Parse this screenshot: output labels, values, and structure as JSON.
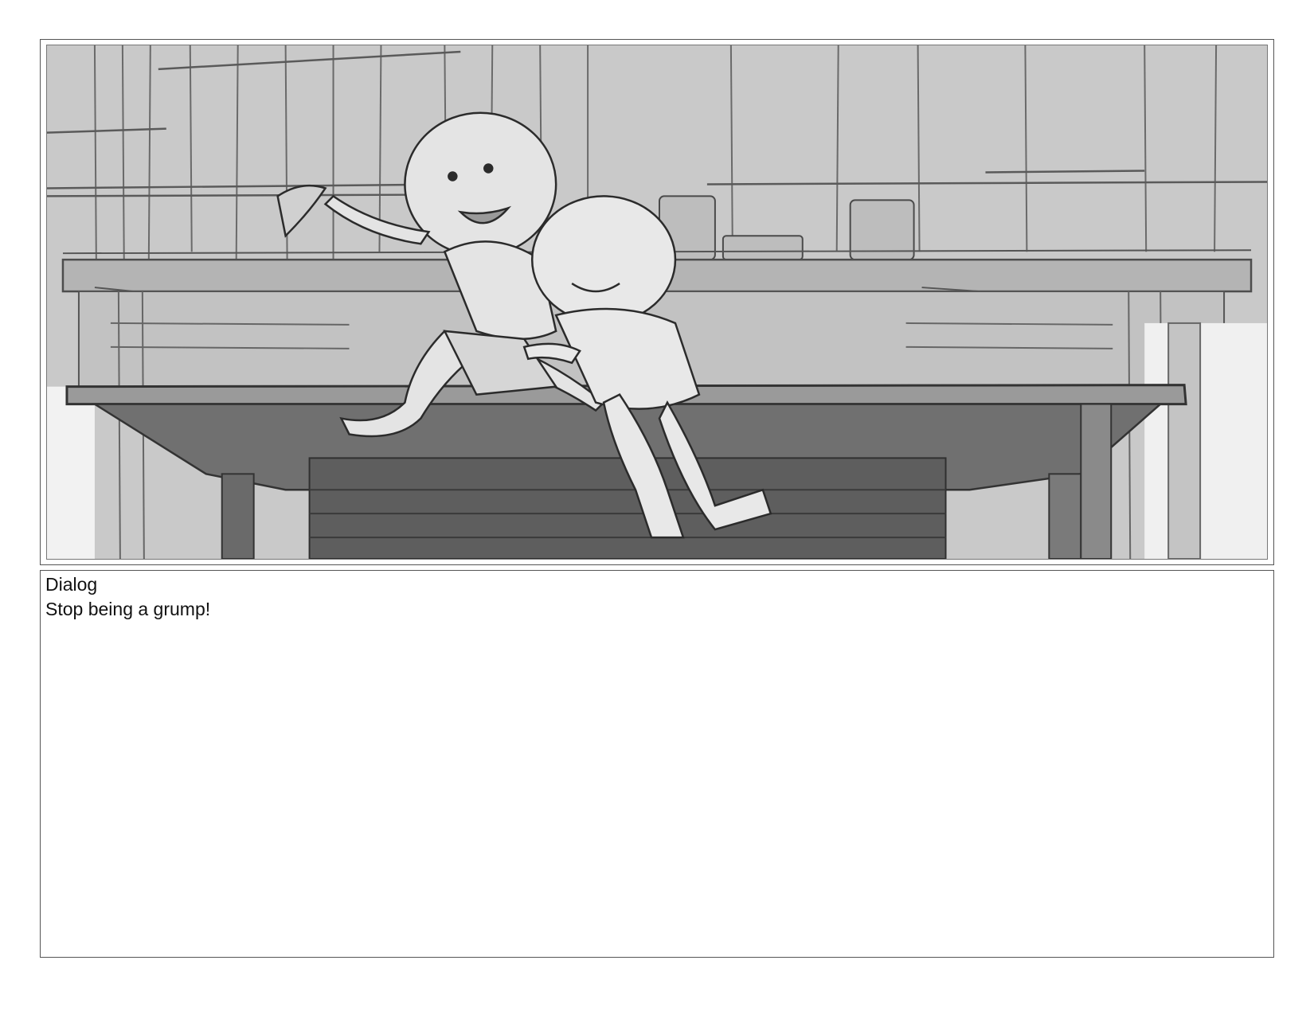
{
  "panel": {
    "image_name": "storyboard-sketch-two-kids-on-wooden-table"
  },
  "notes": {
    "heading": "Dialog",
    "line": "Stop being a grump!"
  },
  "colors": {
    "sketch_background": "#c6c6c6",
    "table_top": "#8f8f8f",
    "table_shadow": "#555555",
    "line_art": "#333333",
    "figure_fill": "#e6e6e6",
    "border": "#555555"
  }
}
